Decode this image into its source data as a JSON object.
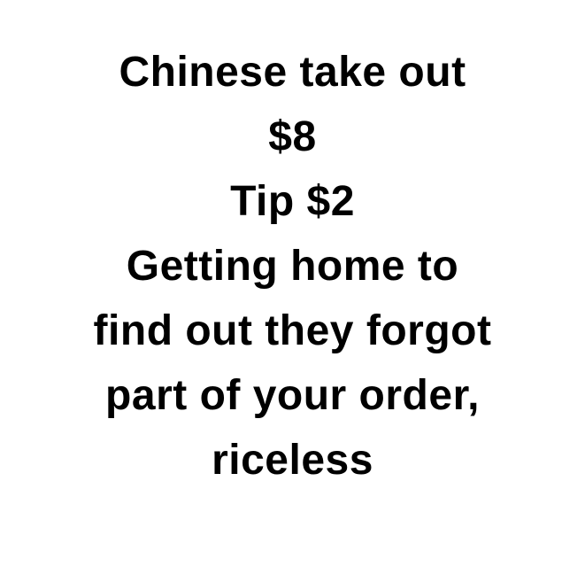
{
  "meme": {
    "lines": [
      "Chinese take out",
      "$8",
      "Tip $2",
      "Getting home to",
      "find out they forgot",
      "part of your order,",
      "riceless"
    ]
  },
  "colors": {
    "background": "#ffffff",
    "text": "#000000"
  }
}
